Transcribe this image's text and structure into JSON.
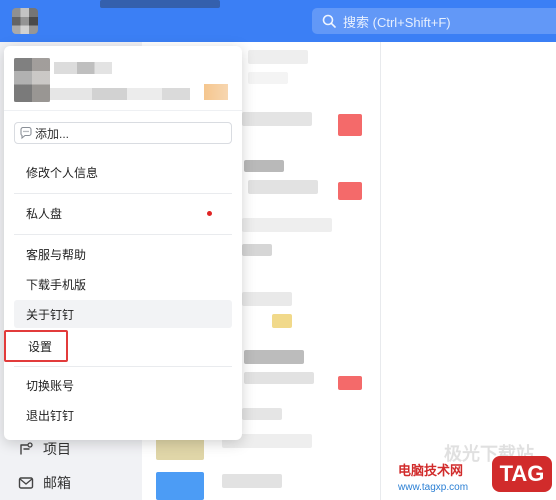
{
  "search": {
    "placeholder": "搜索 (Ctrl+Shift+F)"
  },
  "menu": {
    "status_label": "添加...",
    "items": [
      {
        "label": "修改个人信息"
      },
      {
        "label": "私人盘",
        "has_dot": true
      },
      {
        "label": "客服与帮助"
      },
      {
        "label": "下载手机版"
      },
      {
        "label": "关于钉钉",
        "state": "hover"
      },
      {
        "label": "设置",
        "state": "highlighted"
      },
      {
        "label": "切换账号"
      },
      {
        "label": "退出钉钉"
      }
    ]
  },
  "leftnav": {
    "items": [
      {
        "label": "项目",
        "icon": "project-icon"
      },
      {
        "label": "邮箱",
        "icon": "mail-icon"
      }
    ]
  },
  "watermark": {
    "site_name": "电脑技术网",
    "tag": "TAG",
    "url": "www.tagxp.com",
    "faint_text": "极光下载站"
  },
  "colors": {
    "topbar": "#3b7ff5",
    "highlight_border": "#e23b3b",
    "notification_dot": "#e02424"
  }
}
